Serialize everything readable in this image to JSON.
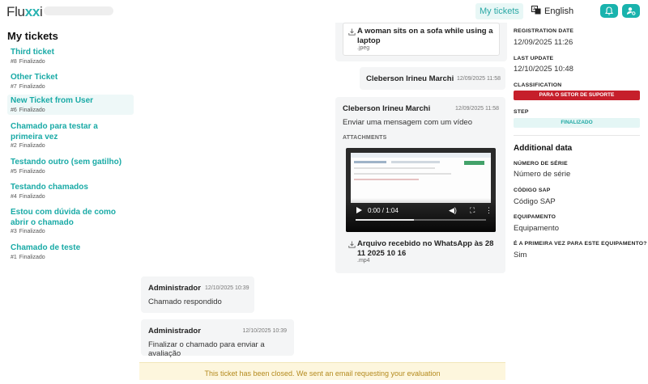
{
  "header": {
    "logo_text_a": "Flu",
    "logo_text_b": "x",
    "logo_text_c": "i",
    "nav_my_tickets": "My tickets",
    "nav_language": "English",
    "accent": "#19b3ad"
  },
  "sidebar": {
    "title": "My tickets",
    "tickets": [
      {
        "title": "Third ticket",
        "number": "#8",
        "status": "Finalizado"
      },
      {
        "title": "Other Ticket",
        "number": "#7",
        "status": "Finalizado"
      },
      {
        "title": "New Ticket from User",
        "number": "#6",
        "status": "Finalizado",
        "active": true
      },
      {
        "title": "Chamado para testar a primeira vez",
        "number": "#2",
        "status": "Finalizado"
      },
      {
        "title": "Testando outro (sem gatilho)",
        "number": "#5",
        "status": "Finalizado"
      },
      {
        "title": "Testando chamados",
        "number": "#4",
        "status": "Finalizado"
      },
      {
        "title": "Estou com dúvida de como abrir o chamado",
        "number": "#3",
        "status": "Finalizado"
      },
      {
        "title": "Chamado de teste",
        "number": "#1",
        "status": "Finalizado"
      }
    ]
  },
  "chat": {
    "attachment_top": {
      "name": "A woman sits on a sofa while using a laptop",
      "ext": ".jpeg"
    },
    "msg_short": {
      "author": "Cleberson Irineu Marchi",
      "time": "12/09/2025 11:58"
    },
    "msg_video": {
      "author": "Cleberson Irineu Marchi",
      "time": "12/09/2025 11:58",
      "body": "Enviar uma mensagem com um vídeo",
      "attachments_label": "ATTACHMENTS",
      "video_time": "0:00 / 1:04",
      "video_progress": 0.0,
      "file_name": "Arquivo recebido no WhatsApp às 28 11 2025 10 16",
      "file_ext": ".mp4"
    },
    "msg_admin_1": {
      "author": "Administrador",
      "time": "12/10/2025 10:39",
      "body": "Chamado respondido"
    },
    "msg_admin_2": {
      "author": "Administrador",
      "time": "12/10/2025 10:39",
      "body": "Finalizar o chamado para enviar a avaliação"
    },
    "closed_banner": "This ticket has been closed. We sent an email requesting your evaluation"
  },
  "details": {
    "registration_label": "REGISTRATION DATE",
    "registration_value": "12/09/2025 11:26",
    "last_update_label": "LAST UPDATE",
    "last_update_value": "12/10/2025 10:48",
    "classification_label": "CLASSIFICATION",
    "classification_value": "PARA O SETOR DE SUPORTE",
    "step_label": "STEP",
    "step_value": "FINALIZADO",
    "additional_title": "Additional data",
    "serial_label": "NÚMERO DE SÉRIE",
    "serial_value": "Número de série",
    "sap_label": "CÓDIGO SAP",
    "sap_value": "Código SAP",
    "equipment_label": "EQUIPAMENTO",
    "equipment_value": "Equipamento",
    "first_time_label": "É A PRIMEIRA VEZ PARA ESTE EQUIPAMENTO?",
    "first_time_value": "Sim"
  }
}
